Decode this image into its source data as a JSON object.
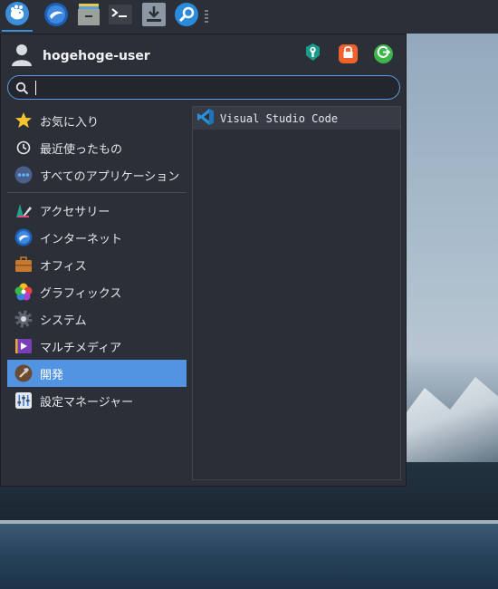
{
  "panel": {
    "items": [
      {
        "name": "whisker-menu-button",
        "icon": "xfce-mouse-icon"
      },
      {
        "name": "web-browser-launcher",
        "icon": "globe-icon"
      },
      {
        "name": "file-manager-launcher",
        "icon": "file-cabinet-icon"
      },
      {
        "name": "terminal-launcher",
        "icon": "terminal-icon"
      },
      {
        "name": "download-launcher",
        "icon": "download-icon"
      },
      {
        "name": "app-finder-launcher",
        "icon": "search-icon"
      }
    ]
  },
  "menu": {
    "username": "hogehoge-user",
    "actions": [
      {
        "name": "settings-manager-action",
        "icon": "wrench-icon",
        "color": "#1a9a8a"
      },
      {
        "name": "lock-screen-action",
        "icon": "lock-icon",
        "color": "#f0622d"
      },
      {
        "name": "logout-action",
        "icon": "logout-icon",
        "color": "#3db54a"
      }
    ],
    "search": {
      "value": "",
      "placeholder": ""
    },
    "categories_top": [
      {
        "label": "お気に入り",
        "icon": "star-icon"
      },
      {
        "label": "最近使ったもの",
        "icon": "clock-icon"
      },
      {
        "label": "すべてのアプリケーション",
        "icon": "dots-icon"
      }
    ],
    "categories": [
      {
        "label": "アクセサリー",
        "icon": "accessories-icon"
      },
      {
        "label": "インターネット",
        "icon": "globe-icon"
      },
      {
        "label": "オフィス",
        "icon": "briefcase-icon"
      },
      {
        "label": "グラフィックス",
        "icon": "palette-icon"
      },
      {
        "label": "システム",
        "icon": "gear-icon"
      },
      {
        "label": "マルチメディア",
        "icon": "multimedia-icon"
      },
      {
        "label": "開発",
        "icon": "hammer-icon",
        "selected": true
      },
      {
        "label": "設定マネージャー",
        "icon": "sliders-icon"
      }
    ],
    "apps": [
      {
        "label": "Visual Studio Code",
        "icon": "vscode-icon"
      }
    ]
  },
  "colors": {
    "accent": "#5294e2",
    "panel": "#2b2f38"
  }
}
